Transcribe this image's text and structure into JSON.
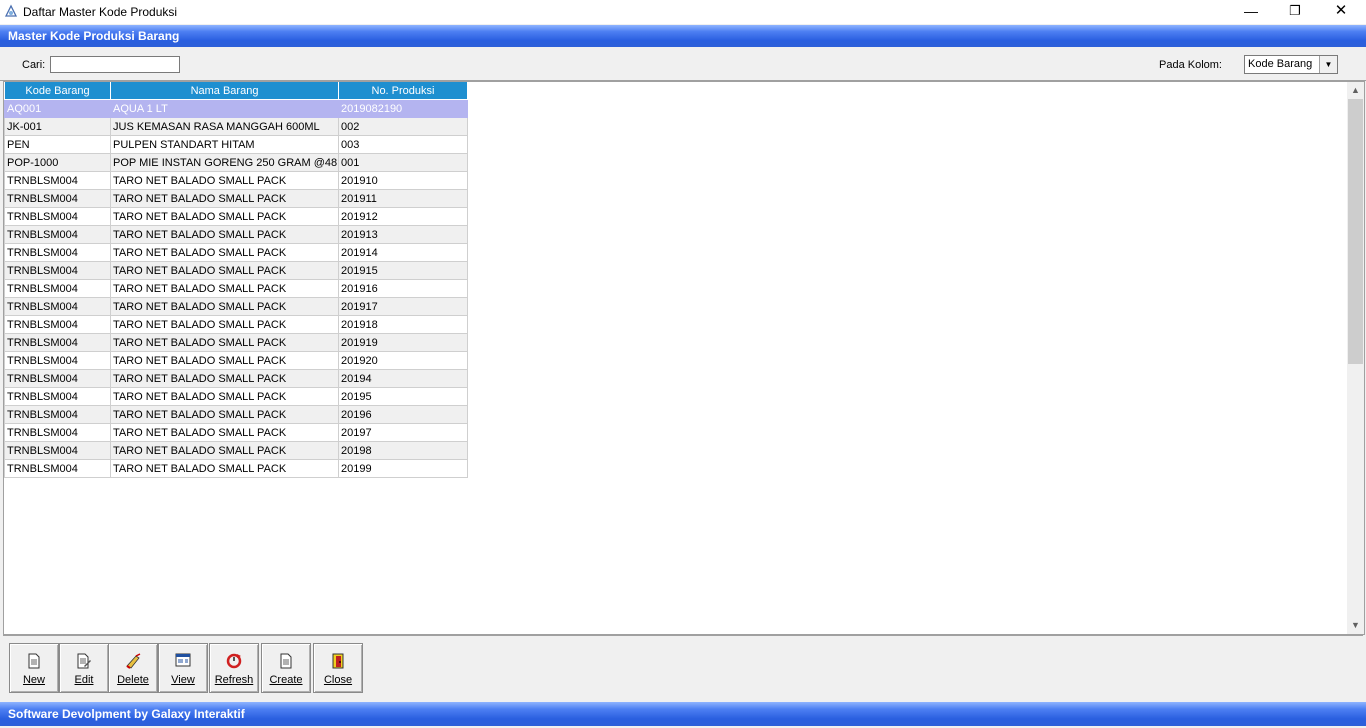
{
  "window": {
    "title": "Daftar Master Kode Produksi",
    "min_icon": "minimize-icon",
    "max_icon": "restore-icon",
    "close_icon": "close-icon"
  },
  "header": {
    "title": "Master Kode Produksi Barang"
  },
  "search": {
    "cari_label": "Cari:",
    "value": "",
    "kolom_label": "Pada Kolom:",
    "kolom_value": "Kode Barang"
  },
  "grid": {
    "columns": [
      "Kode Barang",
      "Nama Barang",
      "No. Produksi"
    ],
    "selected_row": 0,
    "rows": [
      [
        "AQ001",
        "AQUA 1 LT",
        "2019082190"
      ],
      [
        "JK-001",
        "JUS KEMASAN RASA MANGGAH 600ML",
        "002"
      ],
      [
        "PEN",
        "PULPEN STANDART HITAM",
        "003"
      ],
      [
        "POP-1000",
        "POP MIE INSTAN GORENG 250 GRAM @48",
        "001"
      ],
      [
        "TRNBLSM004",
        "TARO NET BALADO SMALL  PACK",
        "201910"
      ],
      [
        "TRNBLSM004",
        "TARO NET BALADO SMALL  PACK",
        "201911"
      ],
      [
        "TRNBLSM004",
        "TARO NET BALADO SMALL  PACK",
        "201912"
      ],
      [
        "TRNBLSM004",
        "TARO NET BALADO SMALL  PACK",
        "201913"
      ],
      [
        "TRNBLSM004",
        "TARO NET BALADO SMALL  PACK",
        "201914"
      ],
      [
        "TRNBLSM004",
        "TARO NET BALADO SMALL  PACK",
        "201915"
      ],
      [
        "TRNBLSM004",
        "TARO NET BALADO SMALL  PACK",
        "201916"
      ],
      [
        "TRNBLSM004",
        "TARO NET BALADO SMALL  PACK",
        "201917"
      ],
      [
        "TRNBLSM004",
        "TARO NET BALADO SMALL  PACK",
        "201918"
      ],
      [
        "TRNBLSM004",
        "TARO NET BALADO SMALL  PACK",
        "201919"
      ],
      [
        "TRNBLSM004",
        "TARO NET BALADO SMALL  PACK",
        "201920"
      ],
      [
        "TRNBLSM004",
        "TARO NET BALADO SMALL  PACK",
        "20194"
      ],
      [
        "TRNBLSM004",
        "TARO NET BALADO SMALL  PACK",
        "20195"
      ],
      [
        "TRNBLSM004",
        "TARO NET BALADO SMALL  PACK",
        "20196"
      ],
      [
        "TRNBLSM004",
        "TARO NET BALADO SMALL  PACK",
        "20197"
      ],
      [
        "TRNBLSM004",
        "TARO NET BALADO SMALL  PACK",
        "20198"
      ],
      [
        "TRNBLSM004",
        "TARO NET BALADO SMALL  PACK",
        "20199"
      ]
    ]
  },
  "toolbar": {
    "buttons": [
      {
        "id": "new",
        "label": "New",
        "icon": "document-icon"
      },
      {
        "id": "edit",
        "label": "Edit",
        "icon": "edit-icon"
      },
      {
        "id": "delete",
        "label": "Delete",
        "icon": "eraser-icon"
      },
      {
        "id": "view",
        "label": "View",
        "icon": "view-window-icon"
      },
      {
        "id": "refresh",
        "label": "Refresh",
        "icon": "refresh-icon"
      },
      {
        "id": "create",
        "label": "Create",
        "icon": "document-icon"
      },
      {
        "id": "close",
        "label": "Close",
        "icon": "exit-door-icon"
      }
    ]
  },
  "footer": {
    "text": "Software Devolpment by Galaxy Interaktif"
  },
  "colors": {
    "header_gradient": "#2a5fe0",
    "grid_header": "#1e8fd0",
    "selected_row": "#b4b4f0",
    "row_alt": "#f0f0f0"
  }
}
